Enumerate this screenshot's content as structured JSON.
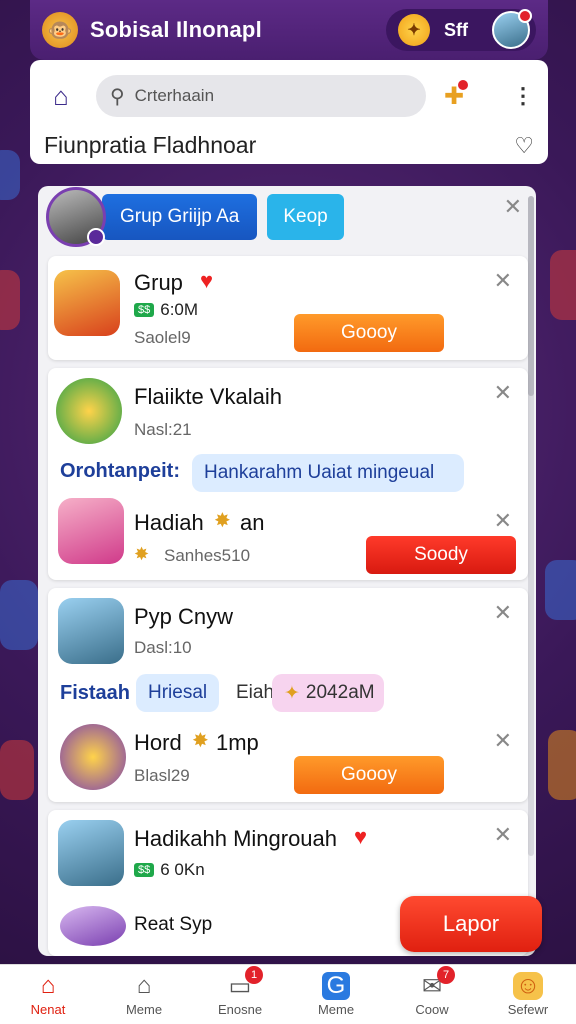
{
  "header": {
    "app_title": "Sobisal Ilnonapl",
    "coin_label": "Sff",
    "logo_icon": "mascot-icon",
    "coin_icon": "coin-icon"
  },
  "search": {
    "placeholder": "Crterhaain",
    "subtitle": "Fiunpratia Fladhnoar"
  },
  "group_bar": {
    "primary_label": "Grup Griijp Aa",
    "secondary_label": "Keop"
  },
  "cards": [
    {
      "title": "Grup",
      "amount": "6:0M",
      "meta": "Saolel9",
      "cta": "Goooy"
    },
    {
      "title": "Flaiikte Vkalaih",
      "meta": "Nasl:21"
    },
    {
      "title": "Hadiah",
      "title_suffix": "an",
      "meta": "Sanhes510",
      "cta": "Soody"
    },
    {
      "title": "Pyp Cnyw",
      "meta": "Dasl:10"
    },
    {
      "title": "Hord",
      "title_suffix": "1mp",
      "meta": "Blasl29",
      "cta": "Goooy"
    },
    {
      "title": "Hadikahh Mingrouah",
      "amount": "6 0Kn"
    },
    {
      "title": "Reat Syp"
    }
  ],
  "rows": {
    "row1_label": "Orohtanpeit:",
    "row1_pill": "Hankarahm Uaiat mingeual",
    "row2_label": "Fistaah",
    "row2_pill1": "Hriesal",
    "row2_pill2": "Eiah",
    "row2_pill3": "2042aM"
  },
  "floating_button": "Lapor",
  "nav": [
    {
      "label": "Nenat",
      "icon": "home-icon",
      "active": true
    },
    {
      "label": "Meme",
      "icon": "house-outline-icon"
    },
    {
      "label": "Enosne",
      "icon": "ticket-icon",
      "badge": "1"
    },
    {
      "label": "Meme",
      "icon": "store-icon"
    },
    {
      "label": "Coow",
      "icon": "mail-icon",
      "badge": "7"
    },
    {
      "label": "Sefewr",
      "icon": "chat-icon"
    }
  ],
  "colors": {
    "header_purple": "#5c2a86",
    "primary_blue": "#1e6fe0",
    "accent_orange": "#f26a10",
    "accent_red": "#e02010"
  }
}
